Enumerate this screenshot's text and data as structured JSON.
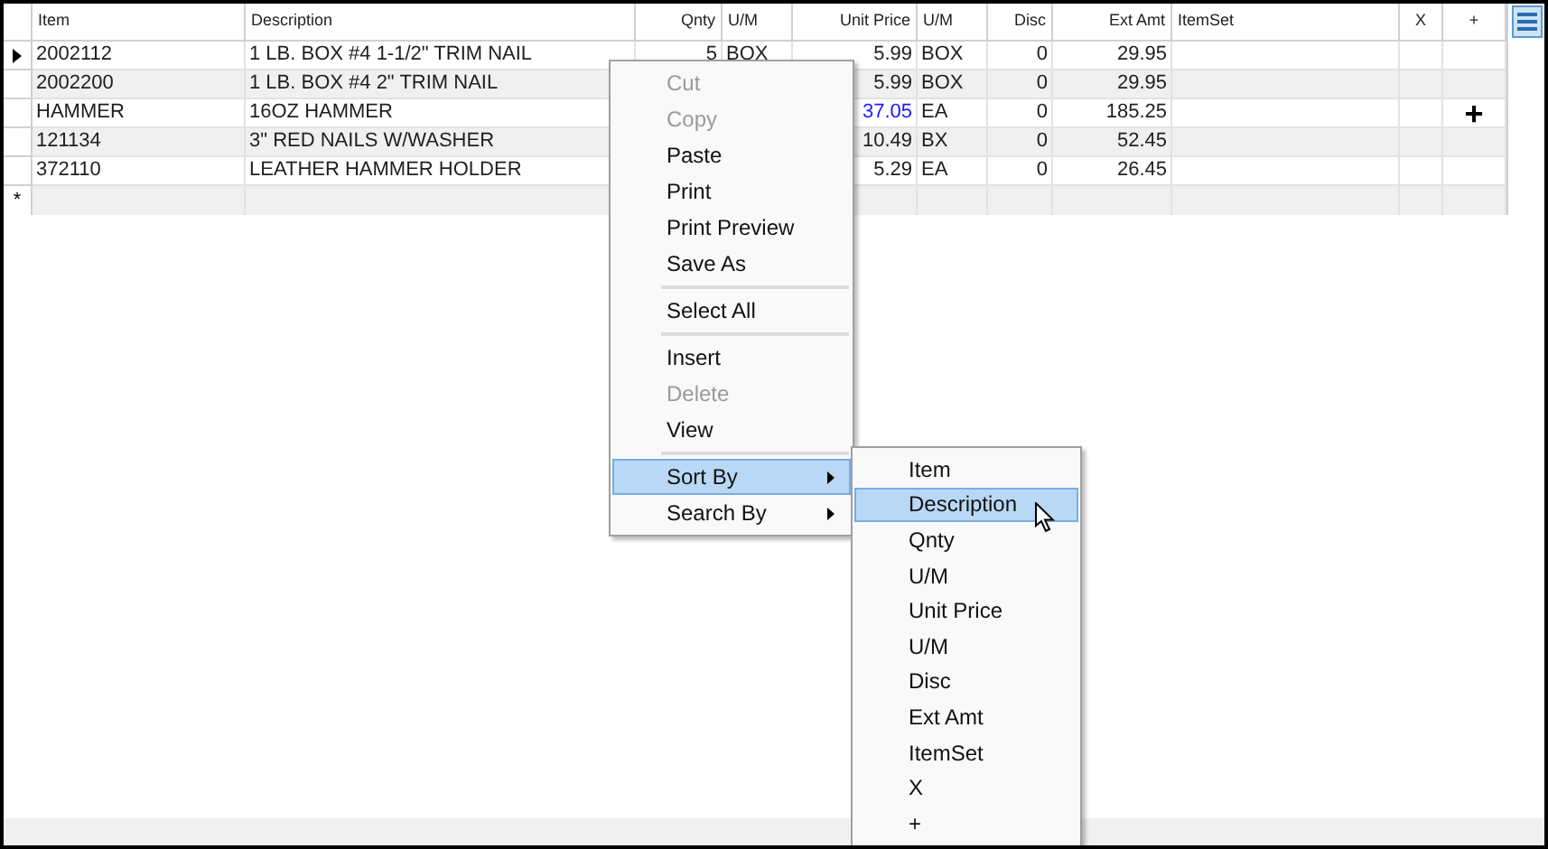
{
  "grid": {
    "columns": [
      "Item",
      "Description",
      "Qnty",
      "U/M",
      "Unit Price",
      "U/M",
      "Disc",
      "Ext Amt",
      "ItemSet",
      "X",
      "+"
    ],
    "rows": [
      {
        "current": true,
        "price_highlighted": false,
        "cells": [
          {
            "text": "2002112"
          },
          {
            "text": "1 LB. BOX #4 1-1/2\" TRIM NAIL"
          },
          {
            "text": "5"
          },
          {
            "text": "BOX"
          },
          {
            "text": "5.99"
          },
          {
            "text": "BOX"
          },
          {
            "text": "0"
          },
          {
            "text": "29.95"
          },
          {},
          {},
          {}
        ]
      },
      {
        "current": false,
        "price_highlighted": false,
        "cells": [
          {
            "text": "2002200"
          },
          {
            "text": "1 LB. BOX #4 2\" TRIM NAIL"
          },
          {},
          {},
          {
            "text": "5.99"
          },
          {
            "text": "BOX"
          },
          {
            "text": "0"
          },
          {
            "text": "29.95"
          },
          {},
          {},
          {}
        ]
      },
      {
        "current": false,
        "price_highlighted": true,
        "cells": [
          {
            "text": "HAMMER"
          },
          {
            "text": "16OZ HAMMER"
          },
          {},
          {},
          {
            "text": "37.05"
          },
          {
            "text": "EA"
          },
          {
            "text": "0"
          },
          {
            "text": "185.25"
          },
          {},
          {},
          {
            "text": "+"
          }
        ]
      },
      {
        "current": false,
        "price_highlighted": false,
        "cells": [
          {
            "text": "121134"
          },
          {
            "text": "3\" RED NAILS W/WASHER"
          },
          {},
          {},
          {
            "text": "10.49"
          },
          {
            "text": "BX"
          },
          {
            "text": "0"
          },
          {
            "text": "52.45"
          },
          {},
          {},
          {}
        ]
      },
      {
        "current": false,
        "price_highlighted": false,
        "cells": [
          {
            "text": "372110"
          },
          {
            "text": "LEATHER HAMMER HOLDER"
          },
          {},
          {},
          {
            "text": "5.29"
          },
          {
            "text": "EA"
          },
          {
            "text": "0"
          },
          {
            "text": "26.45"
          },
          {},
          {},
          {}
        ]
      }
    ],
    "new_row_marker": "*"
  },
  "context_menu": {
    "items": [
      {
        "kind": "item",
        "label": "Cut",
        "disabled": true,
        "selected": false
      },
      {
        "kind": "item",
        "label": "Copy",
        "disabled": true,
        "selected": false
      },
      {
        "kind": "item",
        "label": "Paste",
        "disabled": false,
        "selected": false
      },
      {
        "kind": "item",
        "label": "Print",
        "disabled": false,
        "selected": false
      },
      {
        "kind": "item",
        "label": "Print Preview",
        "disabled": false,
        "selected": false
      },
      {
        "kind": "item",
        "label": "Save As",
        "disabled": false,
        "selected": false
      },
      {
        "kind": "separator"
      },
      {
        "kind": "item",
        "label": "Select All",
        "disabled": false,
        "selected": false
      },
      {
        "kind": "separator"
      },
      {
        "kind": "item",
        "label": "Insert",
        "disabled": false,
        "selected": false
      },
      {
        "kind": "item",
        "label": "Delete",
        "disabled": true,
        "selected": false
      },
      {
        "kind": "item",
        "label": "View",
        "disabled": false,
        "selected": false
      },
      {
        "kind": "separator"
      },
      {
        "kind": "submenu",
        "label": "Sort By",
        "disabled": false,
        "selected": true
      },
      {
        "kind": "submenu",
        "label": "Search By",
        "disabled": false,
        "selected": false
      }
    ]
  },
  "sort_submenu": {
    "items": [
      {
        "label": "Item",
        "selected": false
      },
      {
        "label": "Description",
        "selected": true
      },
      {
        "label": "Qnty",
        "selected": false
      },
      {
        "label": "U/M",
        "selected": false
      },
      {
        "label": "Unit Price",
        "selected": false
      },
      {
        "label": "U/M",
        "selected": false
      },
      {
        "label": "Disc",
        "selected": false
      },
      {
        "label": "Ext Amt",
        "selected": false
      },
      {
        "label": "ItemSet",
        "selected": false
      },
      {
        "label": "X",
        "selected": false
      },
      {
        "label": "+",
        "selected": false
      }
    ]
  }
}
